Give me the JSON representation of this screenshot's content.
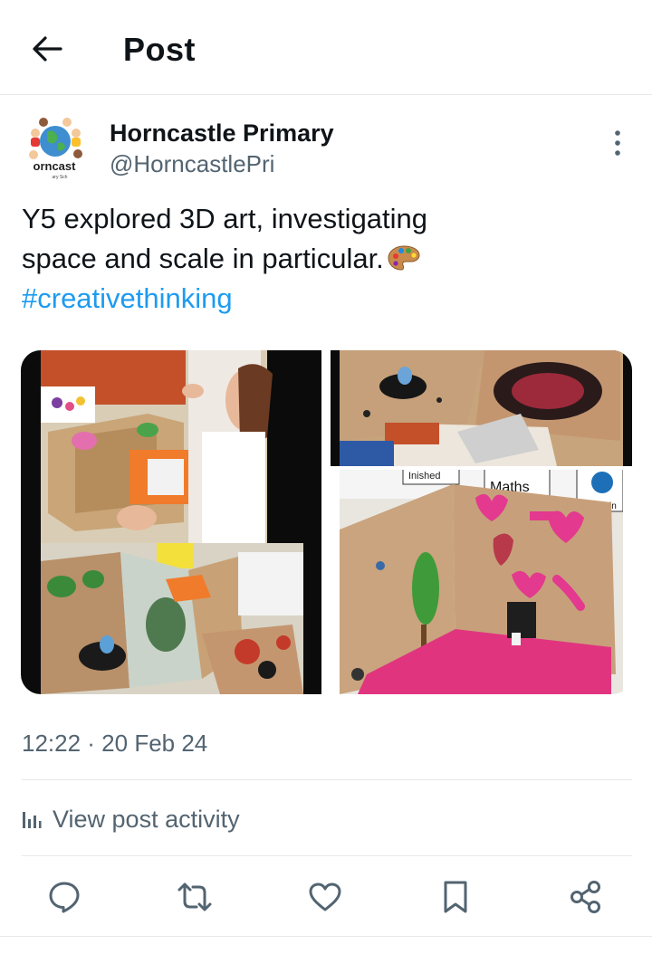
{
  "header": {
    "title": "Post",
    "back_icon": "arrow-left-icon"
  },
  "post": {
    "author": {
      "name": "Horncastle Primary",
      "handle": "@HorncastlePri",
      "avatar_logo_text": "orncast"
    },
    "text_lines": [
      "Y5 explored 3D art, investigating",
      "space and scale in particular."
    ],
    "emoji": "artist-palette-icon",
    "hashtag": "#creativethinking",
    "media": [
      {
        "description": "child painting a cardboard box diorama"
      },
      {
        "description": "close-up of painted diorama corner with figure"
      },
      {
        "description": "top view of diorama with black splatter"
      },
      {
        "description": "box interior painted pink with hearts and green tree",
        "visible_text": [
          "Maths",
          "Inished",
          "Lunchtin"
        ]
      }
    ],
    "timestamp": "12:22 · 20 Feb 24",
    "activity_label": "View post activity"
  },
  "actions": [
    "reply-icon",
    "repost-icon",
    "like-icon",
    "bookmark-icon",
    "share-icon"
  ],
  "colors": {
    "text": "#0f1419",
    "secondary": "#536471",
    "link": "#1d9bf0",
    "divider": "#e6e8ea"
  }
}
